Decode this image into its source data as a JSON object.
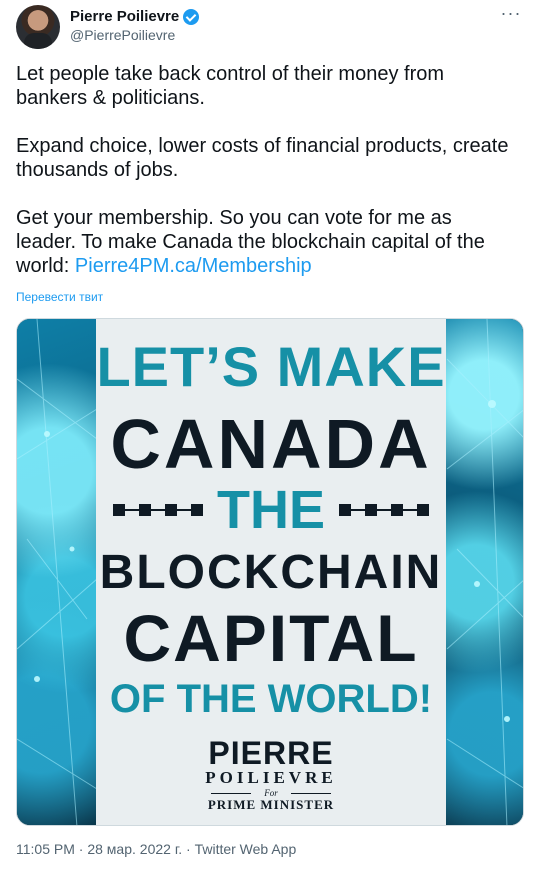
{
  "author": {
    "display_name": "Pierre Poilievre",
    "handle": "@PierrePoilievre",
    "verified": true
  },
  "tweet": {
    "paragraphs": [
      "Let people take back control of their money from bankers & politicians.",
      "Expand choice, lower costs of financial products, create thousands of jobs.",
      "Get your membership. So you can vote for me as leader. To make Canada the blockchain capital of the world: "
    ],
    "link_text": "Pierre4PM.ca/Membership",
    "translate_label": "Перевести твит"
  },
  "media": {
    "line1": "LET’S MAKE",
    "line2": "CANADA",
    "line3": "THE",
    "line4": "BLOCKCHAIN",
    "line5": "CAPITAL",
    "line6": "OF THE WORLD!",
    "sig_first": "PIERRE",
    "sig_last": "POILIEVRE",
    "sig_for": "For",
    "sig_office": "PRIME MINISTER"
  },
  "meta": {
    "time": "11:05 PM",
    "separator": "·",
    "date": "28 мар. 2022 г.",
    "app": "Twitter Web App"
  },
  "colors": {
    "accent": "#1d9bf0",
    "teal": "#1690a6",
    "dark": "#0f1a24"
  },
  "icons": {
    "verified": "verified-badge-icon",
    "more": "more-options-icon"
  }
}
